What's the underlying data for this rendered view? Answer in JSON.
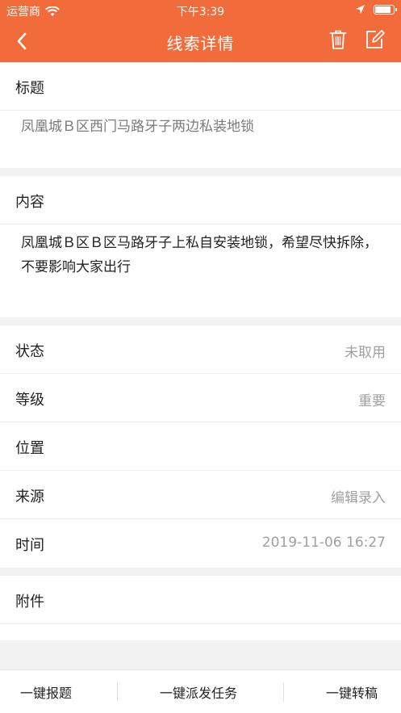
{
  "statusbar": {
    "carrier": "运营商",
    "time": "下午3:39",
    "battery_level": 0.95
  },
  "navbar": {
    "title": "线索详情"
  },
  "title_section": {
    "label": "标题",
    "value": "凤凰城Ｂ区西门马路牙子两边私装地锁"
  },
  "content_section": {
    "label": "内容",
    "value": "凤凰城Ｂ区Ｂ区马路牙子上私自安装地锁，希望尽快拆除，不要影响大家出行"
  },
  "details": [
    {
      "label": "状态",
      "value": "未取用"
    },
    {
      "label": "等级",
      "value": "重要"
    },
    {
      "label": "位置",
      "value": ""
    },
    {
      "label": "来源",
      "value": "编辑录入"
    },
    {
      "label": "时间",
      "value": "2019-11-06 16:27"
    }
  ],
  "attachment": {
    "label": "附件"
  },
  "bottom_actions": {
    "report": "一键报题",
    "dispatch": "一键派发任务",
    "transfer": "一键转稿"
  },
  "colors": {
    "accent": "#f26b3a",
    "value_gray": "#a0a0a0"
  }
}
